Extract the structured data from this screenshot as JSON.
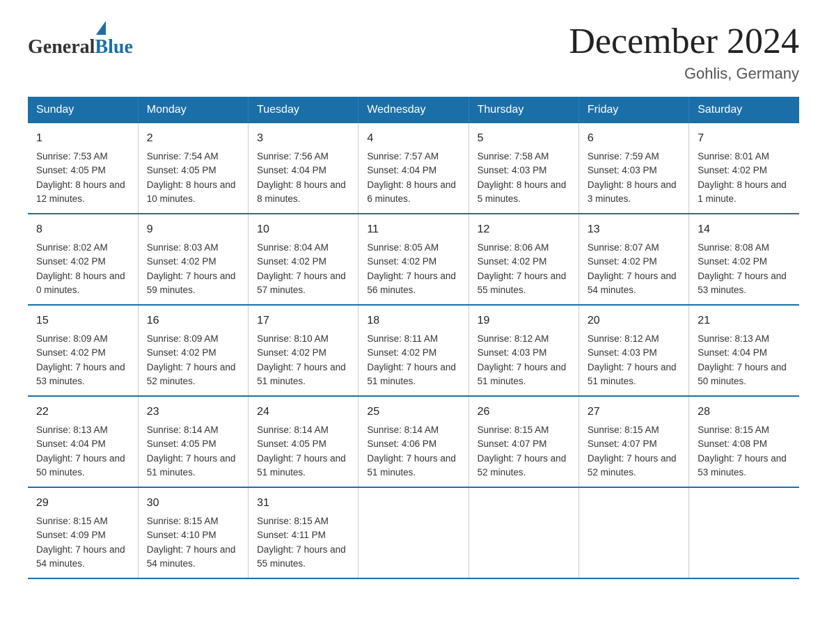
{
  "header": {
    "logo_general": "General",
    "logo_blue": "Blue",
    "title": "December 2024",
    "subtitle": "Gohlis, Germany"
  },
  "days_of_week": [
    "Sunday",
    "Monday",
    "Tuesday",
    "Wednesday",
    "Thursday",
    "Friday",
    "Saturday"
  ],
  "weeks": [
    [
      {
        "day": "1",
        "sunrise": "7:53 AM",
        "sunset": "4:05 PM",
        "daylight": "8 hours and 12 minutes."
      },
      {
        "day": "2",
        "sunrise": "7:54 AM",
        "sunset": "4:05 PM",
        "daylight": "8 hours and 10 minutes."
      },
      {
        "day": "3",
        "sunrise": "7:56 AM",
        "sunset": "4:04 PM",
        "daylight": "8 hours and 8 minutes."
      },
      {
        "day": "4",
        "sunrise": "7:57 AM",
        "sunset": "4:04 PM",
        "daylight": "8 hours and 6 minutes."
      },
      {
        "day": "5",
        "sunrise": "7:58 AM",
        "sunset": "4:03 PM",
        "daylight": "8 hours and 5 minutes."
      },
      {
        "day": "6",
        "sunrise": "7:59 AM",
        "sunset": "4:03 PM",
        "daylight": "8 hours and 3 minutes."
      },
      {
        "day": "7",
        "sunrise": "8:01 AM",
        "sunset": "4:02 PM",
        "daylight": "8 hours and 1 minute."
      }
    ],
    [
      {
        "day": "8",
        "sunrise": "8:02 AM",
        "sunset": "4:02 PM",
        "daylight": "8 hours and 0 minutes."
      },
      {
        "day": "9",
        "sunrise": "8:03 AM",
        "sunset": "4:02 PM",
        "daylight": "7 hours and 59 minutes."
      },
      {
        "day": "10",
        "sunrise": "8:04 AM",
        "sunset": "4:02 PM",
        "daylight": "7 hours and 57 minutes."
      },
      {
        "day": "11",
        "sunrise": "8:05 AM",
        "sunset": "4:02 PM",
        "daylight": "7 hours and 56 minutes."
      },
      {
        "day": "12",
        "sunrise": "8:06 AM",
        "sunset": "4:02 PM",
        "daylight": "7 hours and 55 minutes."
      },
      {
        "day": "13",
        "sunrise": "8:07 AM",
        "sunset": "4:02 PM",
        "daylight": "7 hours and 54 minutes."
      },
      {
        "day": "14",
        "sunrise": "8:08 AM",
        "sunset": "4:02 PM",
        "daylight": "7 hours and 53 minutes."
      }
    ],
    [
      {
        "day": "15",
        "sunrise": "8:09 AM",
        "sunset": "4:02 PM",
        "daylight": "7 hours and 53 minutes."
      },
      {
        "day": "16",
        "sunrise": "8:09 AM",
        "sunset": "4:02 PM",
        "daylight": "7 hours and 52 minutes."
      },
      {
        "day": "17",
        "sunrise": "8:10 AM",
        "sunset": "4:02 PM",
        "daylight": "7 hours and 51 minutes."
      },
      {
        "day": "18",
        "sunrise": "8:11 AM",
        "sunset": "4:02 PM",
        "daylight": "7 hours and 51 minutes."
      },
      {
        "day": "19",
        "sunrise": "8:12 AM",
        "sunset": "4:03 PM",
        "daylight": "7 hours and 51 minutes."
      },
      {
        "day": "20",
        "sunrise": "8:12 AM",
        "sunset": "4:03 PM",
        "daylight": "7 hours and 51 minutes."
      },
      {
        "day": "21",
        "sunrise": "8:13 AM",
        "sunset": "4:04 PM",
        "daylight": "7 hours and 50 minutes."
      }
    ],
    [
      {
        "day": "22",
        "sunrise": "8:13 AM",
        "sunset": "4:04 PM",
        "daylight": "7 hours and 50 minutes."
      },
      {
        "day": "23",
        "sunrise": "8:14 AM",
        "sunset": "4:05 PM",
        "daylight": "7 hours and 51 minutes."
      },
      {
        "day": "24",
        "sunrise": "8:14 AM",
        "sunset": "4:05 PM",
        "daylight": "7 hours and 51 minutes."
      },
      {
        "day": "25",
        "sunrise": "8:14 AM",
        "sunset": "4:06 PM",
        "daylight": "7 hours and 51 minutes."
      },
      {
        "day": "26",
        "sunrise": "8:15 AM",
        "sunset": "4:07 PM",
        "daylight": "7 hours and 52 minutes."
      },
      {
        "day": "27",
        "sunrise": "8:15 AM",
        "sunset": "4:07 PM",
        "daylight": "7 hours and 52 minutes."
      },
      {
        "day": "28",
        "sunrise": "8:15 AM",
        "sunset": "4:08 PM",
        "daylight": "7 hours and 53 minutes."
      }
    ],
    [
      {
        "day": "29",
        "sunrise": "8:15 AM",
        "sunset": "4:09 PM",
        "daylight": "7 hours and 54 minutes."
      },
      {
        "day": "30",
        "sunrise": "8:15 AM",
        "sunset": "4:10 PM",
        "daylight": "7 hours and 54 minutes."
      },
      {
        "day": "31",
        "sunrise": "8:15 AM",
        "sunset": "4:11 PM",
        "daylight": "7 hours and 55 minutes."
      },
      null,
      null,
      null,
      null
    ]
  ]
}
